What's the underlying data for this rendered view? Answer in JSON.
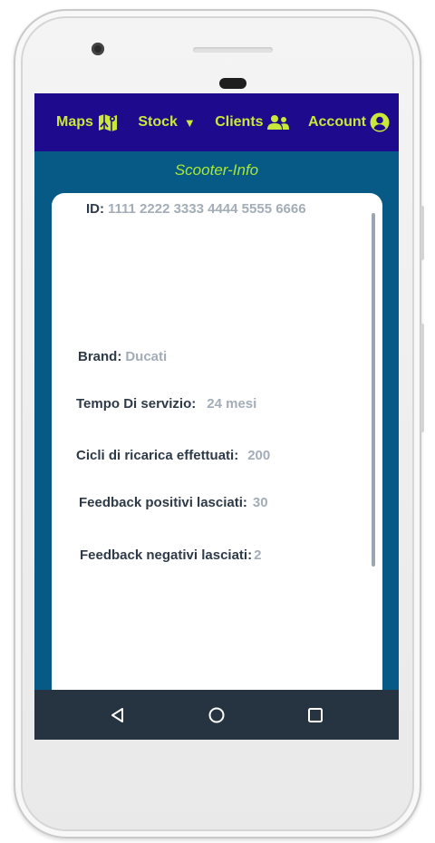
{
  "nav": {
    "maps_label": "Maps",
    "stock_label": "Stock",
    "stock_caret": "▼",
    "clients_label": "Clients",
    "account_label": "Account"
  },
  "screen_title": "Scooter-Info",
  "info": {
    "id_label": "ID:",
    "id_value": "1111 2222 3333 4444 5555 6666",
    "brand_label": "Brand:",
    "brand_value": "Ducati",
    "service_label": "Tempo Di servizio:",
    "service_value": "24 mesi",
    "cycles_label": "Cicli di ricarica effettuati:",
    "cycles_value": "200",
    "pos_feedback_label": "Feedback positivi lasciati:",
    "pos_feedback_value": "30",
    "neg_feedback_label": "Feedback negativi lasciati:",
    "neg_feedback_value": "2"
  },
  "system_nav": {
    "back_icon": "triangle-back-icon",
    "home_icon": "circle-home-icon",
    "recents_icon": "square-recents-icon"
  },
  "colors": {
    "navbar_bg": "#1e0a8c",
    "accent": "#c8e83a",
    "screen_bg": "#065a85",
    "card_bg": "#ffffff",
    "label_text": "#2e3a47",
    "value_text": "#a3adb8",
    "bottom_nav_bg": "#263442"
  }
}
